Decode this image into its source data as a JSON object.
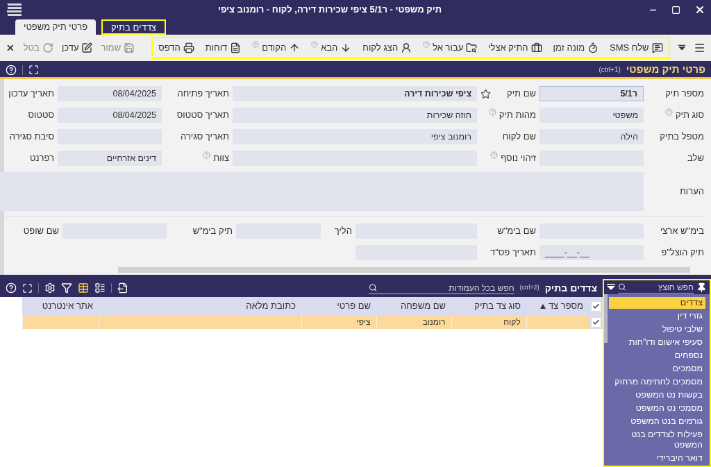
{
  "window": {
    "title": "תיק משפטי - ר5/1 ציפי שכירות דירה, לקוח - רומנוב ציפי"
  },
  "tabs": [
    {
      "label": "צדדים בתיק",
      "selected": false,
      "highlighted": true
    },
    {
      "label": "פרטי תיק משפטי",
      "selected": true,
      "highlighted": false
    }
  ],
  "toolbar": {
    "highlighted": true,
    "items": [
      {
        "label": "שלח SMS",
        "help": false
      },
      {
        "label": "מונה זמן",
        "help": false
      },
      {
        "label": "התיק אצלי",
        "help": false
      },
      {
        "label": "עבור אל",
        "help": true
      },
      {
        "label": "הצג לקוח",
        "help": false
      },
      {
        "label": "הבא",
        "help": true
      },
      {
        "label": "הקודם",
        "help": true
      },
      {
        "label": "דוחות",
        "help": false
      },
      {
        "label": "הדפס",
        "help": false
      }
    ],
    "actions": [
      {
        "label": "שמור",
        "disabled": true
      },
      {
        "label": "עדכן",
        "disabled": false
      },
      {
        "label": "בטל",
        "disabled": true
      }
    ]
  },
  "details": {
    "title": "פרטי תיק משפטי",
    "shortcut": "(ctrl+1)",
    "rows": [
      [
        {
          "kind": "field",
          "label": "מספר תיק",
          "value": "ר5/1",
          "bold": true,
          "focused": true,
          "help": false
        },
        {
          "kind": "field",
          "label": "שם תיק",
          "value": "ציפי שכירות דירה",
          "bold": true,
          "focused": false,
          "help": false,
          "favorite": false
        },
        {
          "kind": "field",
          "label": "תאריך פתיחה",
          "value": "08/04/2025",
          "bold": false,
          "focused": false,
          "help": false
        },
        {
          "kind": "label",
          "label": "תאריך עדכון",
          "help": false
        }
      ],
      [
        {
          "kind": "field",
          "label": "סוג תיק",
          "value": "משפטי",
          "bold": false,
          "focused": false,
          "help": true
        },
        {
          "kind": "field",
          "label": "מהות תיק",
          "value": "חוזה שכירות",
          "bold": false,
          "focused": false,
          "help": true
        },
        {
          "kind": "field",
          "label": "תאריך סטטוס",
          "value": "08/04/2025",
          "bold": false,
          "focused": false,
          "help": false
        },
        {
          "kind": "label",
          "label": "סטטוס",
          "help": false
        }
      ],
      [
        {
          "kind": "field",
          "label": "מטפל בתיק",
          "value": "הילה",
          "bold": false,
          "focused": false,
          "help": false
        },
        {
          "kind": "field",
          "label": "שם לקוח",
          "value": "רומנוב ציפי",
          "bold": false,
          "focused": false,
          "help": false
        },
        {
          "kind": "field",
          "label": "תאריך סגירה",
          "focused": false,
          "help": false
        },
        {
          "kind": "label",
          "label": "סיבת סגירה",
          "help": false
        }
      ],
      [
        {
          "kind": "field",
          "label": "שלב",
          "focused": false,
          "help": false
        },
        {
          "kind": "field",
          "label": "זיהוי נוסף",
          "focused": false,
          "help": true
        },
        {
          "kind": "field",
          "label": "צוות",
          "value": "דינים אזרחיים",
          "bold": false,
          "focused": false,
          "help": true
        },
        {
          "kind": "label",
          "label": "רפרנט",
          "help": false
        }
      ]
    ],
    "notes": {
      "label": "הערות"
    },
    "court_rows": [
      [
        {
          "kind": "field",
          "label": "בימ\"ש ארצי"
        },
        {
          "kind": "field",
          "label": "שם בימ\"ש"
        },
        {
          "kind": "field",
          "label": "הליך"
        },
        {
          "kind": "field",
          "label": "תיק בימ\"ש"
        },
        {
          "kind": "label",
          "label": "שם שופט"
        }
      ],
      [
        {
          "kind": "field",
          "label": "תיק הוצל\"פ",
          "value": "____-__-__"
        },
        {
          "kind": "field",
          "label": "תאריך פס\"ד"
        }
      ]
    ]
  },
  "parties": {
    "title": "צדדים בתיק",
    "shortcut": "(ctrl+2)",
    "search": {
      "placeholder": "חפש בכל העמודות"
    },
    "view_modes": [
      {
        "selected": true
      },
      {
        "selected": false
      }
    ],
    "header_checked": true,
    "columns": [
      {
        "label": "מספר צד",
        "sorted": true
      },
      {
        "label": "סוג צד בתיק",
        "sorted": false
      },
      {
        "label": "שם משפחה",
        "sorted": false
      },
      {
        "label": "שם פרטי",
        "sorted": false
      },
      {
        "label": "כתובת מלאה",
        "sorted": false
      },
      {
        "label": "אתר אינטרנט",
        "sorted": false
      }
    ],
    "rows": [
      {
        "checked": true,
        "selected": true,
        "cells": [
          null,
          "לקוח",
          "רומנוב",
          "ציפי",
          null,
          null
        ]
      }
    ]
  },
  "tab_panel": {
    "highlighted": true,
    "search": {
      "placeholder": "חפש חוצץ"
    },
    "items": [
      {
        "label": "צדדים",
        "selected": true
      },
      {
        "label": "גזרי דין",
        "selected": false
      },
      {
        "label": "שלבי טיפול",
        "selected": false
      },
      {
        "label": "סעיפי אישום ודו\"חות",
        "selected": false
      },
      {
        "label": "נספחים",
        "selected": false
      },
      {
        "label": "מסמכים",
        "selected": false
      },
      {
        "label": "מסמכים לחתימה מרחוק",
        "selected": false
      },
      {
        "label": "בקשות נט המשפט",
        "selected": false
      },
      {
        "label": "מסמכי נט המשפט",
        "selected": false
      },
      {
        "label": "גורמים בנט המשפט",
        "selected": false
      },
      {
        "label": "פעילות לצדדים בנט המשפט",
        "selected": false
      },
      {
        "label": "דואר היברידי",
        "selected": false
      }
    ]
  }
}
